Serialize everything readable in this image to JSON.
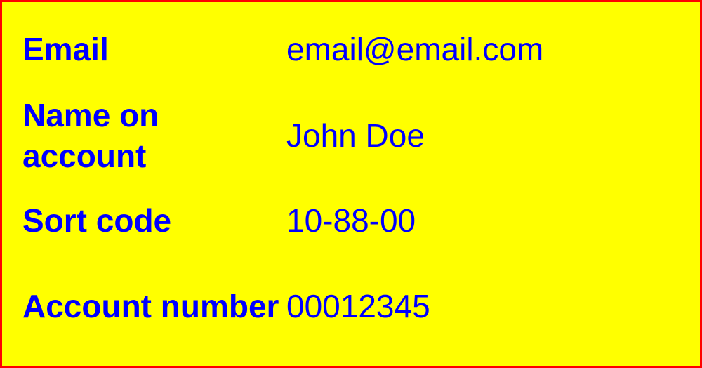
{
  "details": {
    "rows": [
      {
        "label": "Email",
        "value": "email@email.com"
      },
      {
        "label": "Name on account",
        "value": "John Doe"
      },
      {
        "label": "Sort code",
        "value": "10-88-00"
      },
      {
        "label": "Account number",
        "value": "00012345"
      }
    ]
  },
  "colors": {
    "background": "#ffff00",
    "border": "#ff0000",
    "text": "#0000ff"
  }
}
